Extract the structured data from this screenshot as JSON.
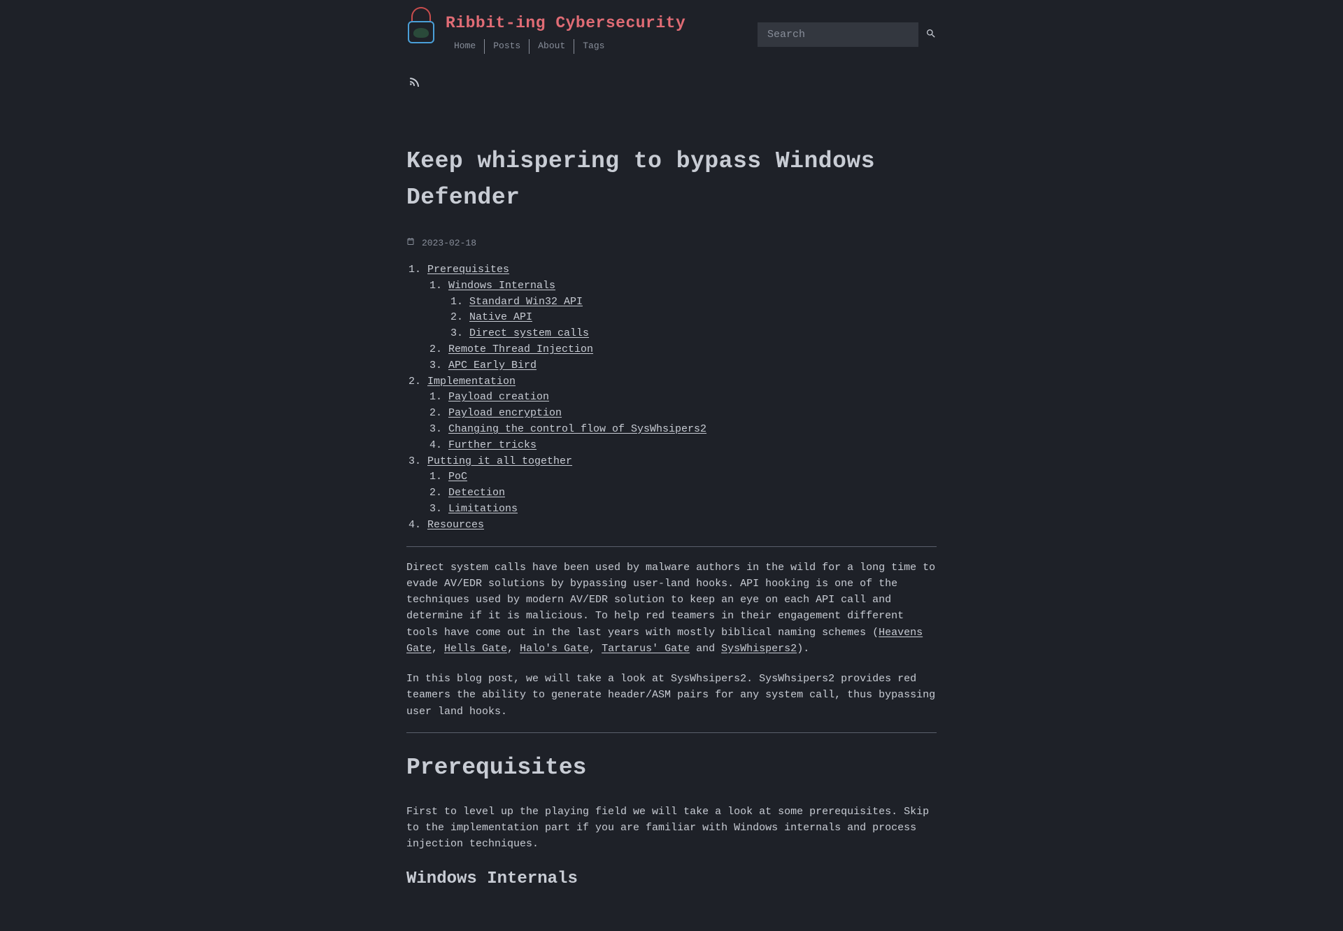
{
  "site": {
    "title": "Ribbit-ing Cybersecurity",
    "nav": {
      "home": "Home",
      "posts": "Posts",
      "about": "About",
      "tags": "Tags"
    },
    "search_placeholder": "Search"
  },
  "post": {
    "title": "Keep whispering to bypass Windows Defender",
    "date": "2023-02-18"
  },
  "toc": {
    "i1": "Prerequisites",
    "i1_1": "Windows Internals",
    "i1_1_1": "Standard Win32 API",
    "i1_1_2": "Native API",
    "i1_1_3": "Direct system calls",
    "i1_2": "Remote Thread Injection",
    "i1_3": "APC Early Bird",
    "i2": "Implementation",
    "i2_1": "Payload creation",
    "i2_2": "Payload encryption",
    "i2_3": "Changing the control flow of SysWhsipers2",
    "i2_4": "Further tricks",
    "i3": "Putting it all together",
    "i3_1": "PoC",
    "i3_2": "Detection",
    "i3_3": "Limitations",
    "i4": "Resources"
  },
  "body": {
    "p1a": "Direct system calls have been used by malware authors in the wild for a long time to evade AV/EDR solutions by bypassing user-land hooks. API hooking is one of the techniques used by modern AV/EDR solution to keep an eye on each API call and determine if it is malicious. To help red teamers in their engagement different tools have come out in the last years with mostly biblical naming schemes (",
    "heavens": "Heavens Gate",
    "c1": ", ",
    "hells": "Hells Gate",
    "c2": ", ",
    "halo": "Halo's Gate",
    "c3": ", ",
    "tartarus": "Tartarus' Gate",
    "c4": " and ",
    "syswhispers": "SysWhispers2",
    "p1b": ").",
    "p2": "In this blog post, we will take a look at SysWhsipers2. SysWhsipers2 provides red teamers the ability to generate header/ASM pairs for any system call, thus bypassing user land hooks.",
    "h_prereq": "Prerequisites",
    "p3": "First to level up the playing field we will take a look at some prerequisites. Skip to the implementation part if you are familiar with Windows internals and process injection techniques.",
    "h_winint": "Windows Internals"
  }
}
